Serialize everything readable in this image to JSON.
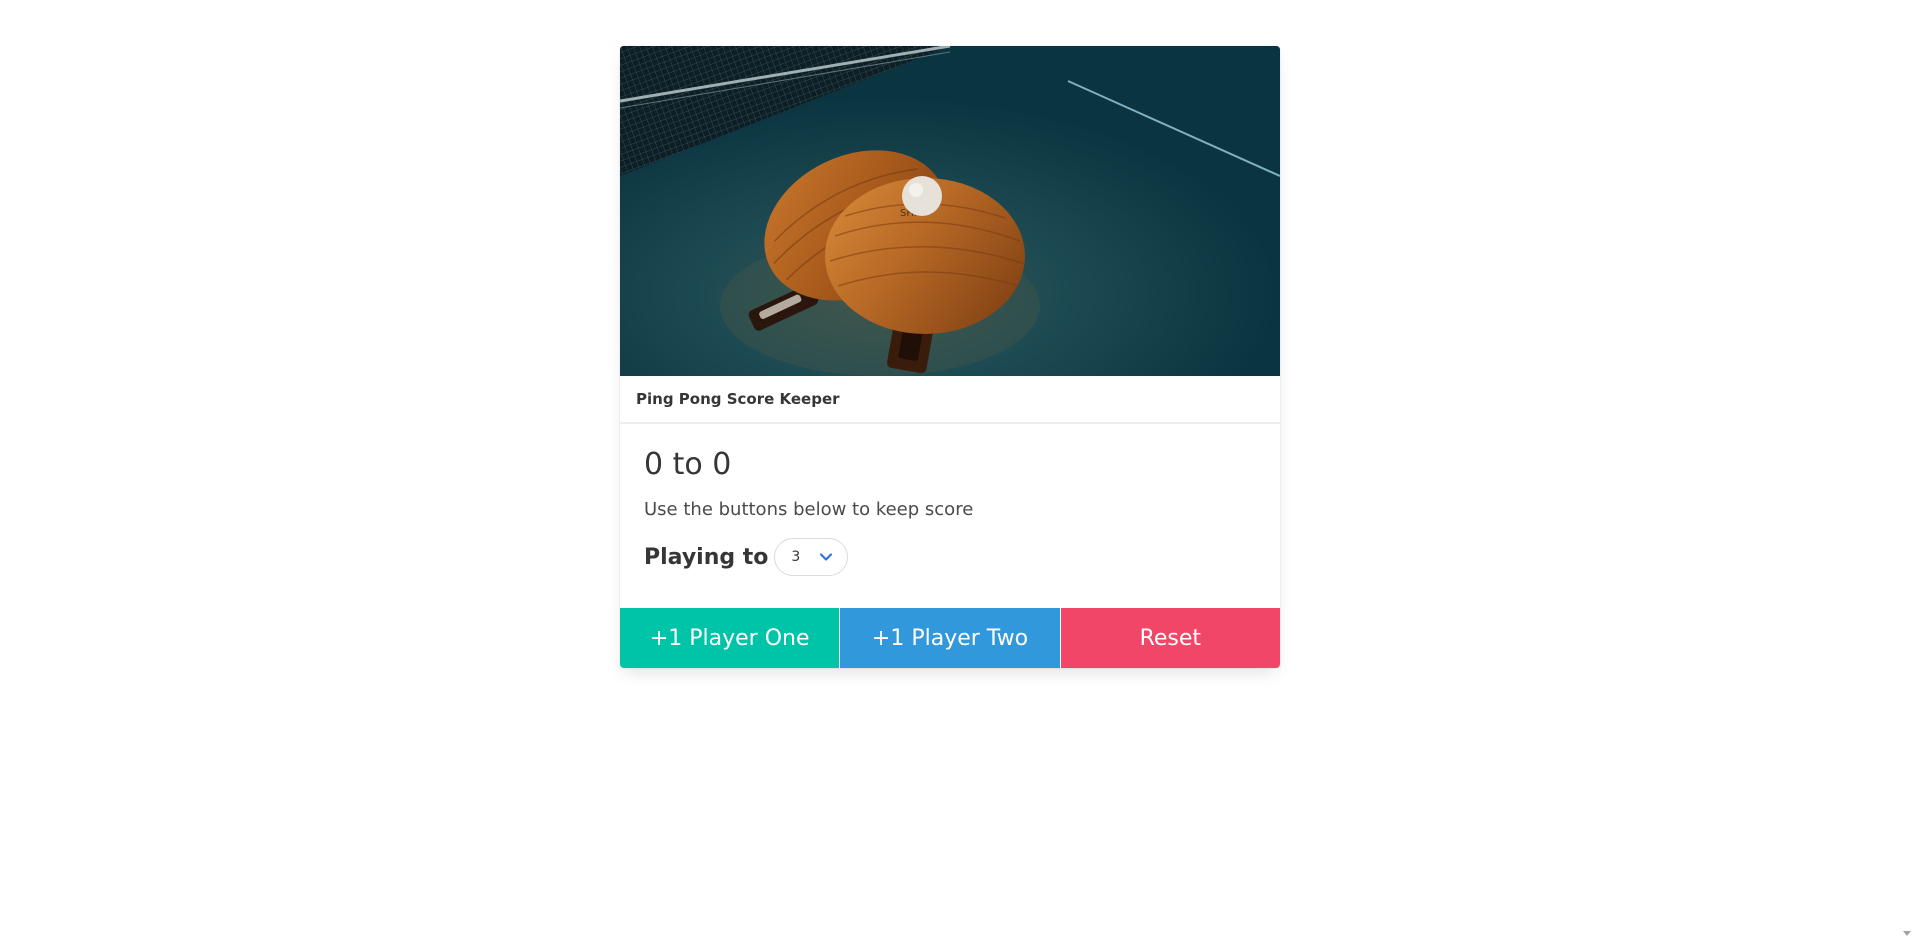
{
  "card": {
    "image_alt": "ping pong paddles and ball on table",
    "header_title": "Ping Pong Score Keeper",
    "score_text": "0 to 0",
    "subtitle": "Use the buttons below to keep score",
    "playing_to_label": "Playing to",
    "playing_to_value": "3"
  },
  "buttons": {
    "player_one": "+1 Player One",
    "player_two": "+1 Player Two",
    "reset": "Reset"
  },
  "icons": {
    "select_arrow": "chevron-down-icon"
  },
  "colors": {
    "player_one": "#00c4a7",
    "player_two": "#3298dc",
    "reset": "#f14668",
    "select_arrow": "#3273dc"
  }
}
